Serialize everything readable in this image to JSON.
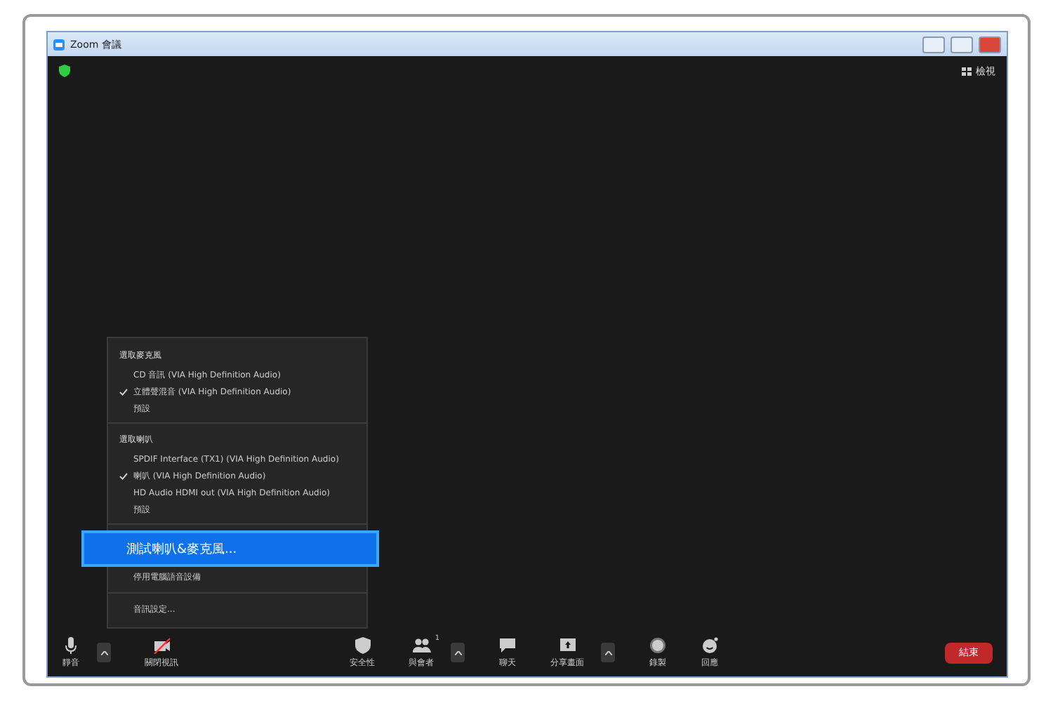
{
  "window": {
    "title": "Zoom 會議"
  },
  "view_button": "檢視",
  "audio_menu": {
    "sections": [
      {
        "heading": "選取麥克風",
        "items": [
          {
            "label": "CD 音訊 (VIA High Definition Audio)",
            "checked": false
          },
          {
            "label": "立體聲混音 (VIA High Definition Audio)",
            "checked": true
          },
          {
            "label": "預設",
            "checked": false
          }
        ]
      },
      {
        "heading": "選取喇叭",
        "items": [
          {
            "label": "SPDIF Interface (TX1) (VIA High Definition Audio)",
            "checked": false
          },
          {
            "label": "喇叭 (VIA High Definition Audio)",
            "checked": true
          },
          {
            "label": "HD Audio HDMI out (VIA High Definition Audio)",
            "checked": false
          },
          {
            "label": "預設",
            "checked": false
          }
        ]
      }
    ],
    "actions": [
      {
        "label": "測試喇叭&麥克風...",
        "selected": true
      },
      {
        "label": "停用電腦語音設備",
        "selected": false
      }
    ],
    "settings": "音訊設定..."
  },
  "toolbar": {
    "left": [
      {
        "kind": "mic",
        "label": "靜音"
      },
      {
        "kind": "video",
        "label": "關閉視訊"
      }
    ],
    "center": [
      {
        "kind": "security",
        "label": "安全性"
      },
      {
        "kind": "participants",
        "label": "與會者",
        "count": "1"
      },
      {
        "kind": "chat",
        "label": "聊天"
      },
      {
        "kind": "share",
        "label": "分享畫面"
      },
      {
        "kind": "record",
        "label": "錄製"
      },
      {
        "kind": "reactions",
        "label": "回應"
      }
    ],
    "end_button": "結束"
  }
}
